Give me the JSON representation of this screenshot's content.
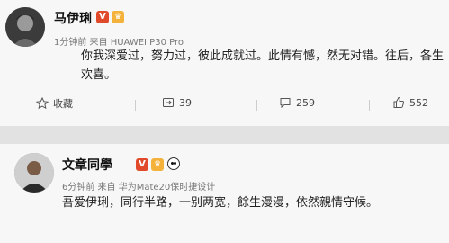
{
  "post1": {
    "username": "马伊琍",
    "meta": "1分钟前 来自 HUAWEI P30 Pro",
    "text": "你我深爱过，努力过，彼此成就过。此情有憾，然无对错。往后，各生欢喜。",
    "actions": {
      "favorite_label": "收藏",
      "repost_count": "39",
      "comment_count": "259",
      "like_count": "552"
    }
  },
  "post2": {
    "username": "文章同學",
    "meta": "6分钟前 来自 华为Mate20保时捷设计",
    "text": "吾爱伊琍，同行半路，一别两宽，餘生漫漫，依然親情守候。"
  },
  "badge_colors": {
    "verified": "#e04a2a",
    "crown": "#f4b23a"
  }
}
